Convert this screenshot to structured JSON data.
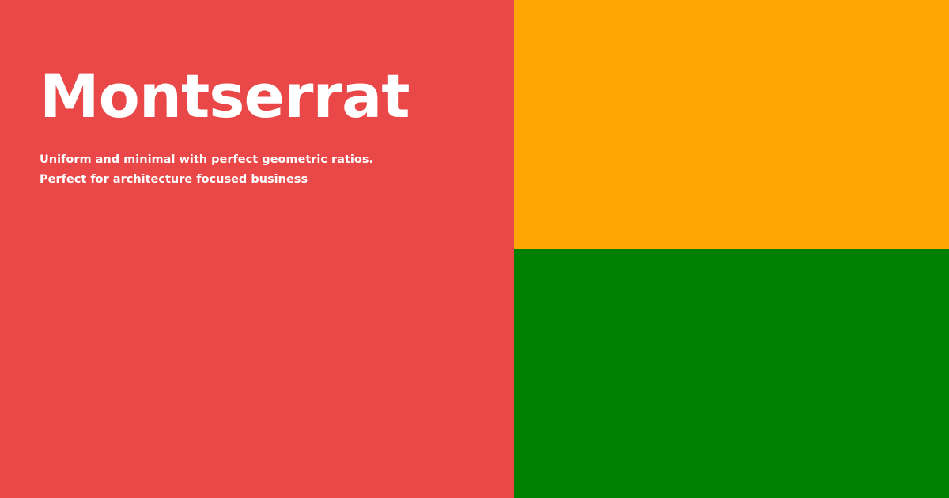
{
  "panel": {
    "title": "Montserrat",
    "tagline": [
      "Uniform and minimal with perfect geometric ratios.",
      "Perfect for architecture focused business"
    ]
  },
  "colors": {
    "left_panel": "#ea4848",
    "top_right_block": "#ffa601",
    "bottom_right_block": "#017f01",
    "text": "#ffffff"
  }
}
